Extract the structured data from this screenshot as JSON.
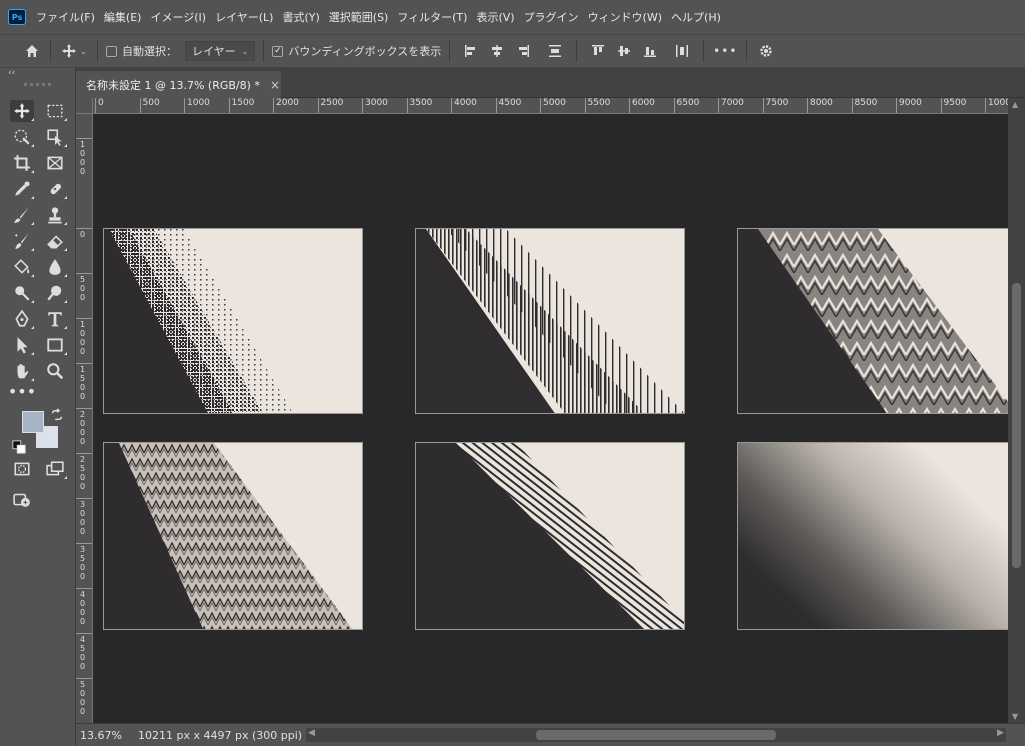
{
  "app": {
    "logo": "Ps"
  },
  "menu": [
    "ファイル(F)",
    "編集(E)",
    "イメージ(I)",
    "レイヤー(L)",
    "書式(Y)",
    "選択範囲(S)",
    "フィルター(T)",
    "表示(V)",
    "プラグイン",
    "ウィンドウ(W)",
    "ヘルプ(H)"
  ],
  "options": {
    "auto_select_label": "自動選択：",
    "auto_select_checked": false,
    "layer_dropdown": "レイヤー",
    "bounding_box_label": "バウンディングボックスを表示",
    "bounding_box_checked": true,
    "more_icon": "•••"
  },
  "toolbar": {
    "collapse_icon": "‹‹",
    "more_tools": "•••",
    "foreground_color": "#a7b4c6",
    "background_color": "#d9e2ee"
  },
  "document": {
    "tab_title": "名称未設定 1 @ 13.7% (RGB/8) *",
    "close_icon": "×"
  },
  "rulers": {
    "horizontal": [
      "0",
      "500",
      "1000",
      "1500",
      "2000",
      "2500",
      "3000",
      "3500",
      "4000",
      "4500",
      "5000",
      "5500",
      "6000",
      "6500",
      "7000",
      "7500",
      "8000",
      "8500",
      "9000",
      "9500",
      "1000"
    ],
    "vertical": [
      "1000",
      "0",
      "500",
      "1000",
      "1500",
      "2000",
      "2500",
      "3000",
      "3500",
      "4000",
      "4500",
      "5000"
    ]
  },
  "status": {
    "zoom": "13.67%",
    "doc_info": "10211 px x 4497 px (300 ppi)",
    "arrow": "›"
  }
}
